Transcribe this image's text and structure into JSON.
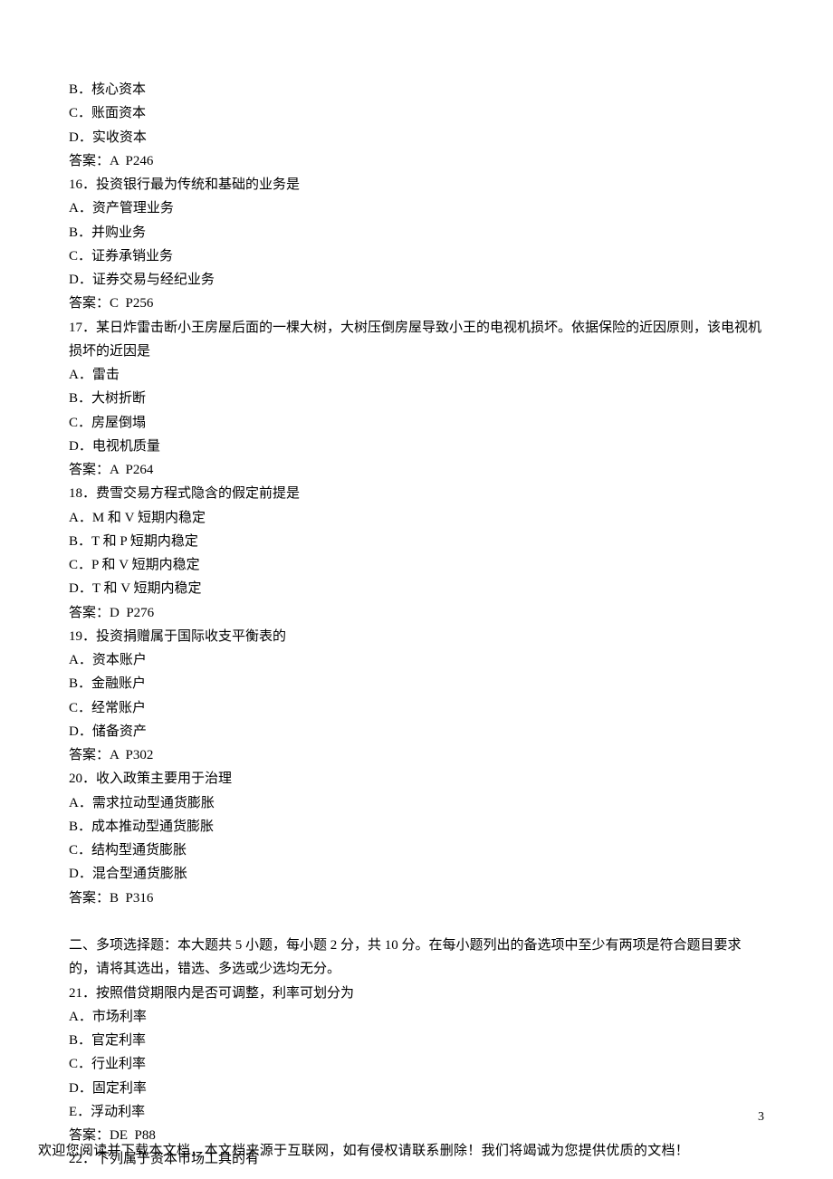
{
  "lines": [
    "B．核心资本",
    "C．账面资本",
    "D．实收资本",
    "答案：A  P246",
    "16．投资银行最为传统和基础的业务是",
    "A．资产管理业务",
    "B．并购业务",
    "C．证券承销业务",
    "D．证券交易与经纪业务",
    "答案：C  P256",
    "17．某日炸雷击断小王房屋后面的一棵大树，大树压倒房屋导致小王的电视机损坏。依据保险的近因原则，该电视机损坏的近因是",
    "A．雷击",
    "B．大树折断",
    "C．房屋倒塌",
    "D．电视机质量",
    "答案：A  P264",
    "18．费雪交易方程式隐含的假定前提是",
    "A．M 和 V 短期内稳定",
    "B．T 和 P 短期内稳定",
    "C．P 和 V 短期内稳定",
    "D．T 和 V 短期内稳定",
    "答案：D  P276",
    "19．投资捐赠属于国际收支平衡表的",
    "A．资本账户",
    "B．金融账户",
    "C．经常账户",
    "D．储备资产",
    "答案：A  P302",
    "20．收入政策主要用于治理",
    "A．需求拉动型通货膨胀",
    "B．成本推动型通货膨胀",
    "C．结构型通货膨胀",
    "D．混合型通货膨胀",
    "答案：B  P316",
    "",
    "二、多项选择题：本大题共 5 小题，每小题 2 分，共 10 分。在每小题列出的备选项中至少有两项是符合题目要求的，请将其选出，错选、多选或少选均无分。",
    "21．按照借贷期限内是否可调整，利率可划分为",
    "A．市场利率",
    "B．官定利率",
    "C．行业利率",
    "D．固定利率",
    "E．浮动利率",
    "答案：DE  P88",
    "22．下列属于资本市场工具的有"
  ],
  "page_number": "3",
  "footer": "欢迎您阅读并下载本文档，本文档来源于互联网，如有侵权请联系删除！我们将竭诚为您提供优质的文档！"
}
